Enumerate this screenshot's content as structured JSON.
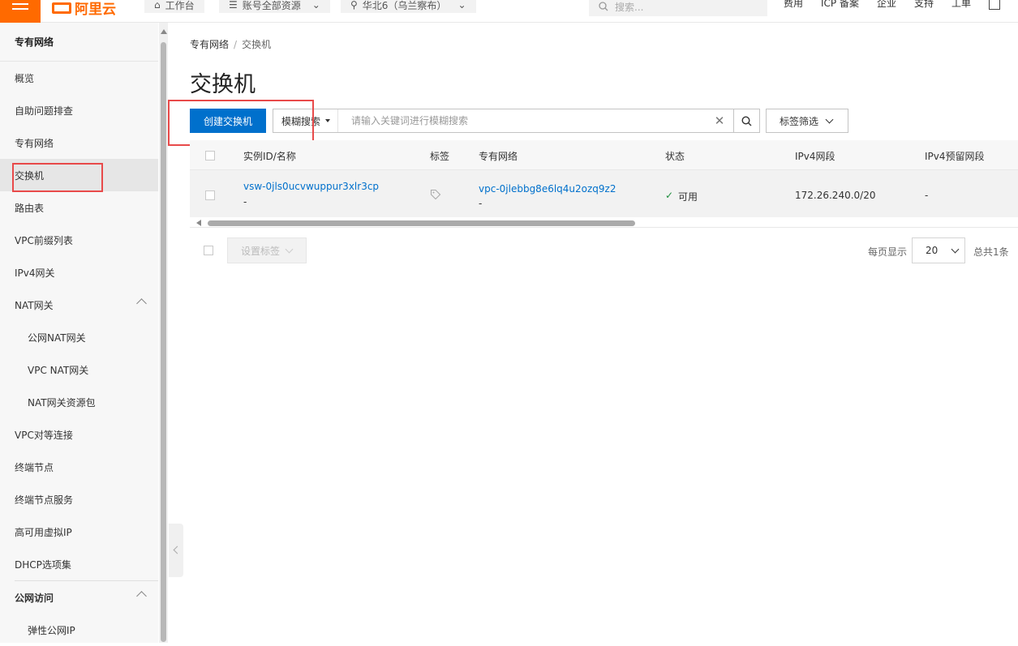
{
  "topbar": {
    "logo_text": "阿里云",
    "workbench": "工作台",
    "resource_group": "账号全部资源",
    "region": "华北6（乌兰察布）",
    "search_placeholder": "搜索...",
    "links": [
      "费用",
      "ICP 备案",
      "企业",
      "支持",
      "工单"
    ]
  },
  "sidebar": {
    "title": "专有网络",
    "items": [
      {
        "label": "概览"
      },
      {
        "label": "自助问题排查"
      },
      {
        "label": "专有网络"
      },
      {
        "label": "交换机"
      },
      {
        "label": "路由表"
      },
      {
        "label": "VPC前缀列表"
      },
      {
        "label": "IPv4网关"
      },
      {
        "label": "NAT网关"
      },
      {
        "label": "公网NAT网关"
      },
      {
        "label": "VPC NAT网关"
      },
      {
        "label": "NAT网关资源包"
      },
      {
        "label": "VPC对等连接"
      },
      {
        "label": "终端节点"
      },
      {
        "label": "终端节点服务"
      },
      {
        "label": "高可用虚拟IP"
      },
      {
        "label": "DHCP选项集"
      },
      {
        "label": "公网访问"
      },
      {
        "label": "弹性公网IP"
      }
    ]
  },
  "breadcrumb": {
    "parent": "专有网络",
    "separator": "/",
    "current": "交换机"
  },
  "page_title": "交换机",
  "toolbar": {
    "create_label": "创建交换机",
    "search_mode": "模糊搜索",
    "search_placeholder": "请输入关键词进行模糊搜索",
    "tag_filter": "标签筛选"
  },
  "table": {
    "columns": [
      "实例ID/名称",
      "标签",
      "专有网络",
      "状态",
      "IPv4网段",
      "IPv4预留网段"
    ],
    "rows": [
      {
        "id": "vsw-0jls0ucvwuppur3xlr3cp",
        "name": "-",
        "vpc_id": "vpc-0jlebbg8e6lq4u2ozq9z2",
        "vpc_name": "-",
        "status": "可用",
        "ipv4": "172.26.240.0/20",
        "reserved": "-"
      }
    ]
  },
  "footer": {
    "set_tags": "设置标签",
    "per_page_label": "每页显示",
    "page_size": "20",
    "total": "总共1条"
  },
  "colors": {
    "primary": "#0070cc",
    "brand": "#ff6a00",
    "highlight": "#e84a4a",
    "success": "#1e8e3e"
  }
}
